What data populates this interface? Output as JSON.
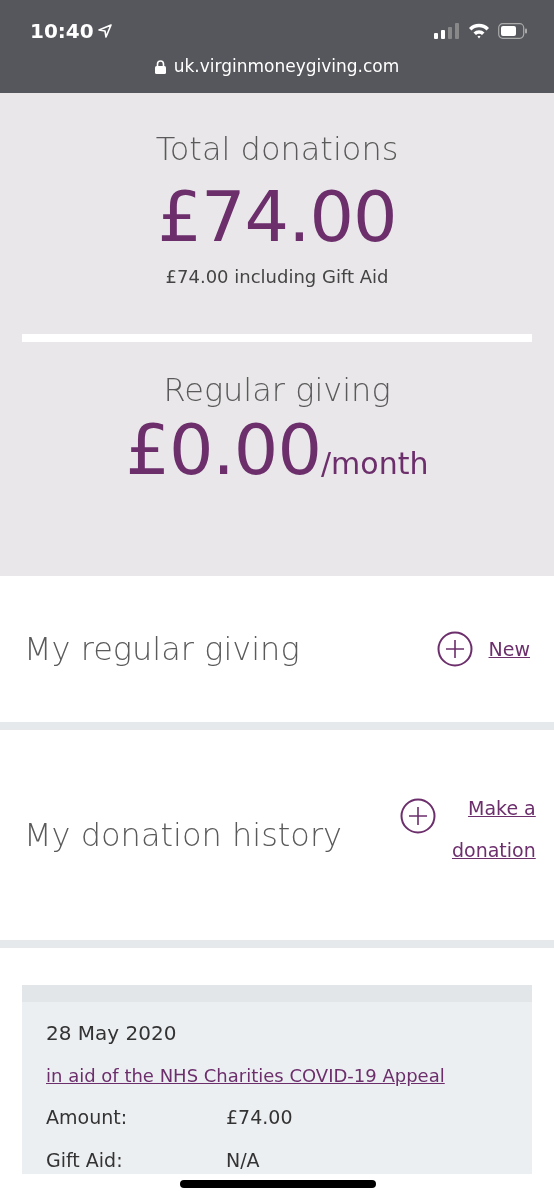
{
  "status_bar": {
    "time": "10:40",
    "url": "uk.virginmoneygiving.com"
  },
  "summary": {
    "total_label": "Total donations",
    "total_amount": "£74.00",
    "gift_aid_note": "£74.00 including Gift Aid",
    "regular_label": "Regular giving",
    "regular_amount": "£0.00",
    "regular_period": "/month"
  },
  "sections": [
    {
      "title": "My regular giving",
      "action": "New"
    },
    {
      "title": "My donation history",
      "action": "Make a donation"
    }
  ],
  "donations": [
    {
      "date": "28 May 2020",
      "cause": "in aid of the NHS Charities COVID-19 Appeal",
      "fields": [
        {
          "label": "Amount:",
          "value": "£74.00"
        },
        {
          "label": "Gift Aid:",
          "value": "N/A"
        }
      ]
    }
  ]
}
